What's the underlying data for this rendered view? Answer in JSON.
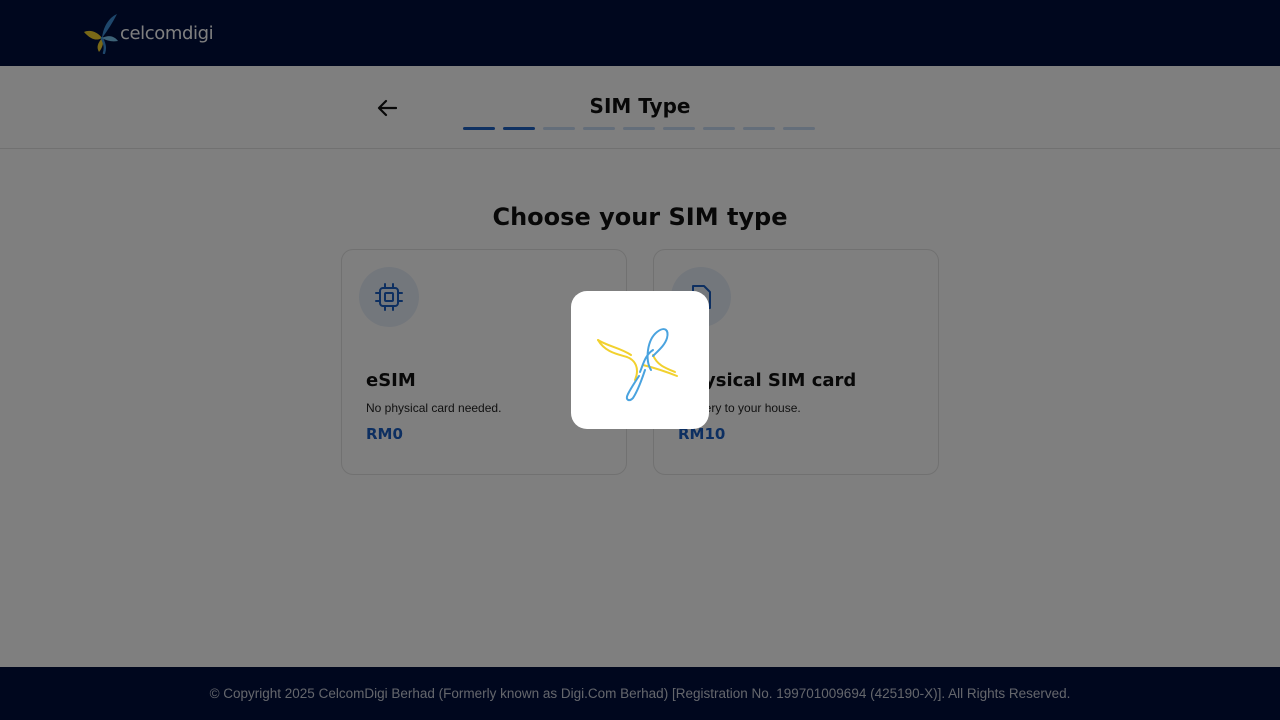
{
  "header": {
    "brand": "celcomdigi",
    "logo_icon": "butterfly-logo-icon"
  },
  "subheader": {
    "back_icon": "arrow-left-icon",
    "title": "SIM Type",
    "progress": {
      "total_steps": 9,
      "completed_steps": 2
    }
  },
  "main": {
    "heading": "Choose your SIM type",
    "options": [
      {
        "icon": "chip-icon",
        "title": "eSIM",
        "description": "No physical card needed.",
        "price": "RM0"
      },
      {
        "icon": "sim-card-icon",
        "title": "Physical SIM card",
        "description": "Delivery to your house.",
        "price": "RM10"
      }
    ]
  },
  "footer": {
    "copyright": "© Copyright 2025 CelcomDigi Berhad (Formerly known as Digi.Com Berhad) [Registration No. 199701009694 (425190-X)]. All Rights Reserved."
  },
  "loading_overlay": {
    "visible": true,
    "icon": "butterfly-loading-icon"
  },
  "colors": {
    "navy": "#010f3d",
    "accent_blue": "#1a5fc2",
    "progress_done": "#1f62c5",
    "progress_pending": "#c9dcf5",
    "logo_yellow": "#f2d12e",
    "logo_blue": "#4aa3df"
  }
}
